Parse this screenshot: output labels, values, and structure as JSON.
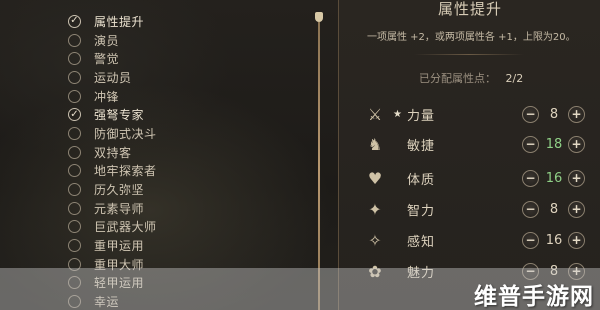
{
  "feats": [
    {
      "label": "属性提升",
      "state": "checked"
    },
    {
      "label": "演员",
      "state": "empty"
    },
    {
      "label": "警觉",
      "state": "empty"
    },
    {
      "label": "运动员",
      "state": "empty"
    },
    {
      "label": "冲锋",
      "state": "empty"
    },
    {
      "label": "强弩专家",
      "state": "checked"
    },
    {
      "label": "防御式决斗",
      "state": "empty"
    },
    {
      "label": "双持客",
      "state": "empty"
    },
    {
      "label": "地牢探索者",
      "state": "empty"
    },
    {
      "label": "历久弥坚",
      "state": "empty"
    },
    {
      "label": "元素导师",
      "state": "empty"
    },
    {
      "label": "巨武器大师",
      "state": "empty"
    },
    {
      "label": "重甲运用",
      "state": "empty"
    },
    {
      "label": "重甲大师",
      "state": "empty"
    },
    {
      "label": "轻甲运用",
      "state": "empty"
    },
    {
      "label": "幸运",
      "state": "empty"
    }
  ],
  "panel": {
    "title": "属性提升",
    "description": "一项属性 +2，或两项属性各 +1，上限为20。",
    "points_label": "已分配属性点：",
    "points_value": "2/2",
    "attributes": [
      {
        "name": "力量",
        "value": "8",
        "starred": true,
        "boosted": false,
        "icon": "sword-arm-icon",
        "glyph": "⚔"
      },
      {
        "name": "敏捷",
        "value": "18",
        "starred": false,
        "boosted": true,
        "icon": "boot-icon",
        "glyph": "♞"
      },
      {
        "name": "体质",
        "value": "16",
        "starred": false,
        "boosted": true,
        "icon": "heart-shield-icon",
        "glyph": "♥"
      },
      {
        "name": "智力",
        "value": "8",
        "starred": false,
        "boosted": false,
        "icon": "book-icon",
        "glyph": "✦"
      },
      {
        "name": "感知",
        "value": "16",
        "starred": false,
        "boosted": false,
        "icon": "eye-scroll-icon",
        "glyph": "✧"
      },
      {
        "name": "魅力",
        "value": "8",
        "starred": false,
        "boosted": false,
        "icon": "mask-icon",
        "glyph": "✿"
      }
    ],
    "minus_glyph": "−",
    "plus_glyph": "+",
    "star_glyph": "★"
  },
  "watermark": "维普手游网",
  "colors": {
    "boosted": "#8fcf86",
    "accent": "#b89870"
  }
}
